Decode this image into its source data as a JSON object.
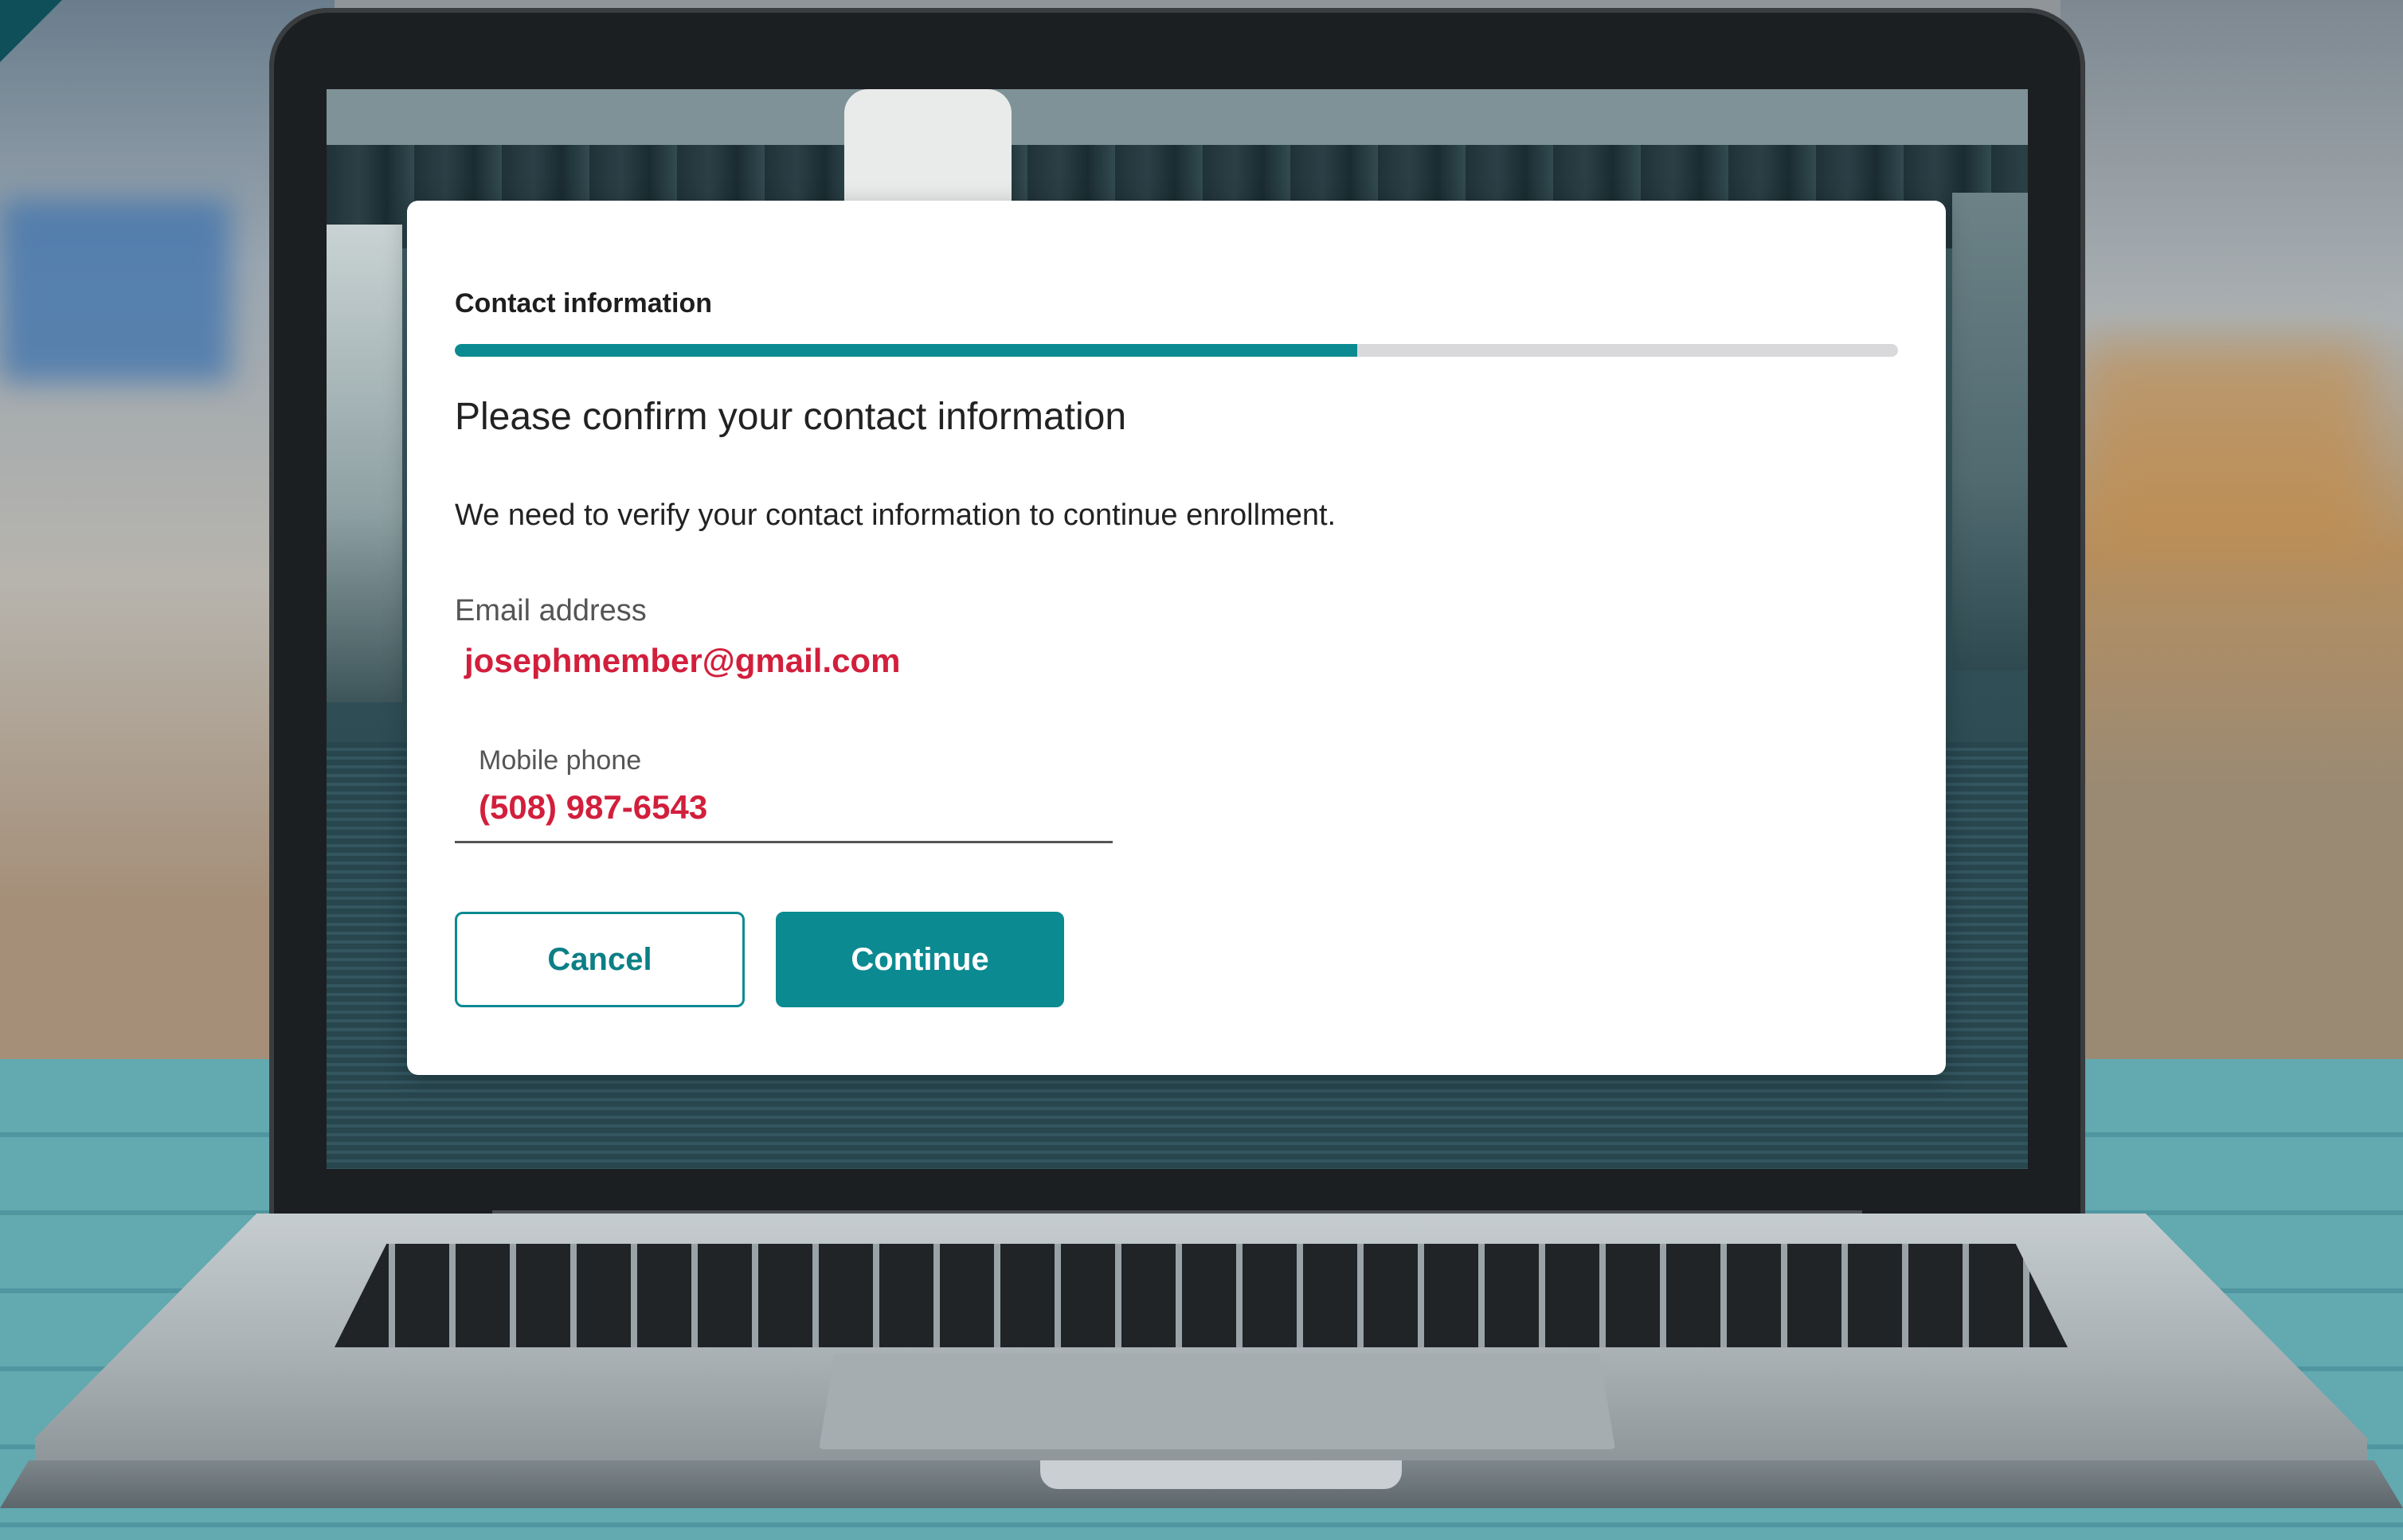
{
  "wizard": {
    "step_title": "Contact information",
    "progress_percent": 62.5,
    "heading": "Please confirm your contact information",
    "intro": "We need to verify your contact information to continue enrollment."
  },
  "email": {
    "label": "Email address",
    "value": "josephmember@gmail.com"
  },
  "phone": {
    "label": "Mobile phone",
    "value": "(508) 987-6543"
  },
  "actions": {
    "cancel_label": "Cancel",
    "continue_label": "Continue"
  },
  "colors": {
    "accent": "#0c8a91",
    "value_highlight": "#d21f3c",
    "progress_track": "#d9d9dc"
  }
}
